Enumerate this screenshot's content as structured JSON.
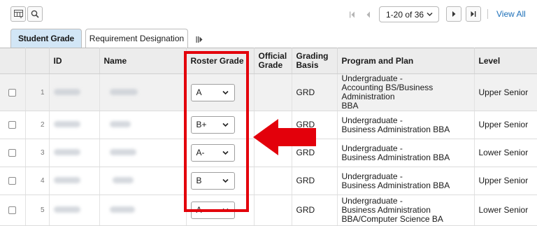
{
  "toolbar": {
    "pager_range": "1-20 of 36",
    "view_all": "View All"
  },
  "tabs": [
    {
      "label": "Student Grade",
      "active": true
    },
    {
      "label": "Requirement Designation",
      "active": false
    }
  ],
  "grid": {
    "headers": [
      "ID",
      "Name",
      "Roster Grade",
      "Official Grade",
      "Grading Basis",
      "Program and Plan",
      "Level"
    ],
    "rows": [
      {
        "num": "1",
        "roster_grade": "A",
        "grading_basis": "GRD",
        "program": "Undergraduate -",
        "plan": [
          "Accounting BS/Business Administration",
          "BBA"
        ],
        "level": "Upper Senior"
      },
      {
        "num": "2",
        "roster_grade": "B+",
        "grading_basis": "GRD",
        "program": "Undergraduate -",
        "plan": [
          "Business Administration BBA"
        ],
        "level": "Upper Senior"
      },
      {
        "num": "3",
        "roster_grade": "A-",
        "grading_basis": "GRD",
        "program": "Undergraduate -",
        "plan": [
          "Business Administration BBA"
        ],
        "level": "Lower Senior"
      },
      {
        "num": "4",
        "roster_grade": "B",
        "grading_basis": "GRD",
        "program": "Undergraduate -",
        "plan": [
          "Business Administration BBA"
        ],
        "level": "Upper Senior"
      },
      {
        "num": "5",
        "roster_grade": "A",
        "grading_basis": "GRD",
        "program": "Undergraduate -",
        "plan": [
          "Business Administration",
          "BBA/Computer Science BA"
        ],
        "level": "Lower Senior"
      }
    ]
  },
  "colors": {
    "highlight": "#e3000b",
    "tab_active_bg": "#d2e6f6",
    "header_bg": "#ececec",
    "link": "#1c6fb8"
  }
}
